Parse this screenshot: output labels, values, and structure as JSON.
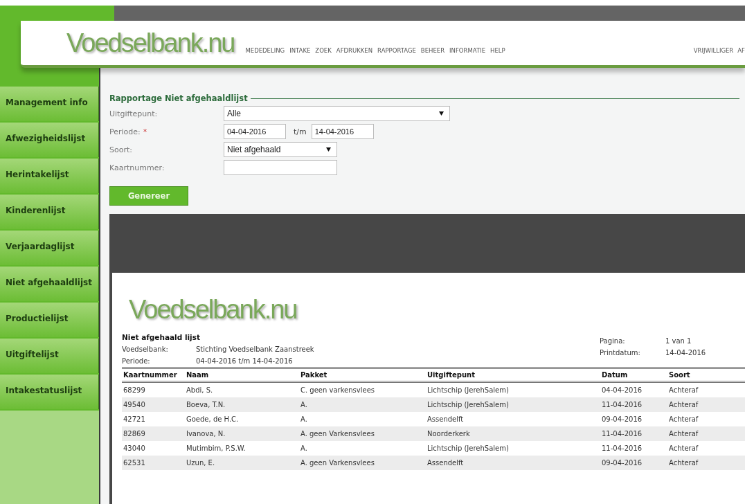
{
  "header": {
    "logo": "Voedselbank.nu",
    "nav": [
      "MEDEDELING",
      "INTAKE",
      "ZOEK",
      "AFDRUKKEN",
      "RAPPORTAGE",
      "BEHEER",
      "INFORMATIE",
      "HELP"
    ],
    "user_menu": [
      "VRIJWILLIGER",
      "AF"
    ]
  },
  "sidebar": {
    "items": [
      "Management info",
      "Afwezigheidslijst",
      "Herintakelijst",
      "Kinderenlijst",
      "Verjaardaglijst",
      "Niet afgehaaldlijst",
      "Productielijst",
      "Uitgiftelijst",
      "Intakestatuslijst"
    ]
  },
  "form": {
    "title": "Rapportage Niet afgehaaldlijst",
    "fields": [
      {
        "label": "Uitgiftepunt:",
        "kind": "select",
        "value": "Alle"
      },
      {
        "label": "Periode:",
        "required_mark": "*",
        "kind": "range",
        "value": "04-04-2016",
        "separator": "t/m",
        "value_to": "14-04-2016"
      },
      {
        "label": "Soort:",
        "kind": "select_small",
        "value": "Niet afgehaald"
      },
      {
        "label": "Kaartnummer:",
        "kind": "text"
      }
    ],
    "button": "Genereer"
  },
  "report": {
    "logo": "Voedselbank.nu",
    "title": "Niet afgehaald lijst",
    "meta_left": [
      {
        "label": "Voedselbank:",
        "value": "Stichting Voedselbank Zaanstreek"
      },
      {
        "label": "Periode:",
        "value": "04-04-2016  t/m  14-04-2016"
      }
    ],
    "meta_right": [
      {
        "label": "Pagina:",
        "value": "1 van 1"
      },
      {
        "label": "Printdatum:",
        "value": "14-04-2016"
      }
    ],
    "table": {
      "columns": [
        "Kaartnummer",
        "Naam",
        "Pakket",
        "Uitgiftepunt",
        "Datum",
        "Soort"
      ],
      "rows": [
        [
          "68299",
          "Abdi, S.",
          "C. geen varkensvlees",
          "Lichtschip (JerehSalem)",
          "04-04-2016",
          "Achteraf"
        ],
        [
          "49540",
          "Boeva, T.N.",
          "A.",
          "Lichtschip (JerehSalem)",
          "11-04-2016",
          "Achteraf"
        ],
        [
          "42721",
          "Goede, de H.C.",
          "A.",
          "Assendelft",
          "09-04-2016",
          "Achteraf"
        ],
        [
          "82869",
          "Ivanova, N.",
          "A. geen Varkensvlees",
          "Noorderkerk",
          "11-04-2016",
          "Achteraf"
        ],
        [
          "43040",
          "Mutimbim, P.S.W.",
          "A.",
          "Lichtschip (JerehSalem)",
          "11-04-2016",
          "Achteraf"
        ],
        [
          "62531",
          "Uzun, E.",
          "A. geen Varkensvlees",
          "Assendelft",
          "09-04-2016",
          "Achteraf"
        ]
      ]
    }
  }
}
